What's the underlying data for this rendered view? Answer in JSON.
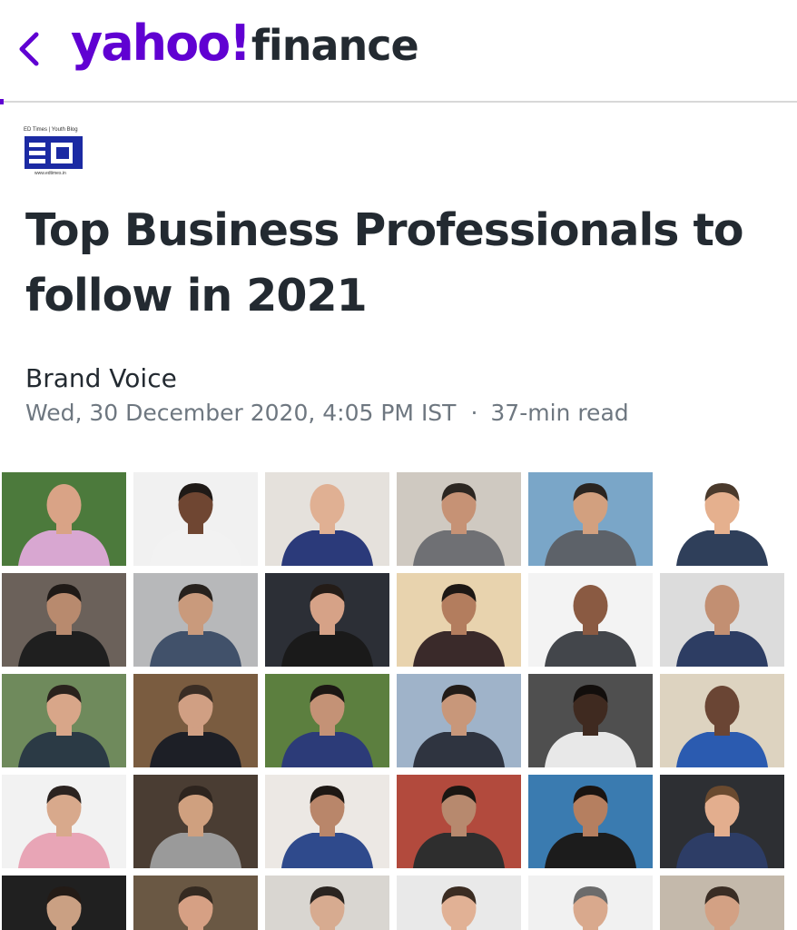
{
  "header": {
    "back_icon": "chevron-left-icon",
    "logo_yahoo": "yahoo!",
    "logo_finance": "finance",
    "brand_color": "#6001d2"
  },
  "publisher": {
    "top_text": "ED Times | Youth Blog",
    "mark": "ED",
    "url": "www.edtimes.in",
    "color": "#1b2aa3"
  },
  "article": {
    "title": "Top Business Professionals to follow in 2021",
    "brand": "Brand Voice",
    "date": "Wed, 30 December 2020, 4:05 PM IST",
    "separator": "·",
    "read_time": "37-min read"
  },
  "grid": {
    "photos": [
      {
        "bg": "#4c7a3c",
        "shirt": "#d8a7d1",
        "skin": "#d9a386",
        "hair": "none"
      },
      {
        "bg": "#f1f1f1",
        "shirt": "#f2f2f2",
        "skin": "#6f4632",
        "hair": "#1f1a17"
      },
      {
        "bg": "#e5e1dc",
        "shirt": "#2b3a7a",
        "skin": "#e0b093",
        "hair": "none"
      },
      {
        "bg": "#cfc9c1",
        "shirt": "#6f7074",
        "skin": "#c69275",
        "hair": "#2c2621"
      },
      {
        "bg": "#7aa6c8",
        "shirt": "#5d6269",
        "skin": "#d2a07f",
        "hair": "#2a2420"
      },
      {
        "bg": "#ffffff",
        "shirt": "#2f3f5a",
        "skin": "#e5b08e",
        "hair": "#4a3a2c"
      },
      {
        "bg": "#6b615a",
        "shirt": "#1f1f1f",
        "skin": "#b88a6e",
        "hair": "#1f1a17"
      },
      {
        "bg": "#b7b8ba",
        "shirt": "#41516a",
        "skin": "#c99a7c",
        "hair": "#27211d"
      },
      {
        "bg": "#2c2f36",
        "shirt": "#1a1a1a",
        "skin": "#d6a287",
        "hair": "#241c17"
      },
      {
        "bg": "#e8d3ae",
        "shirt": "#3a2a2a",
        "skin": "#b37d5e",
        "hair": "#1d1714"
      },
      {
        "bg": "#f3f3f3",
        "shirt": "#43464b",
        "skin": "#8a5a42",
        "hair": "none"
      },
      {
        "bg": "#dcdcdc",
        "shirt": "#2d3d63",
        "skin": "#c28f72",
        "hair": "none"
      },
      {
        "bg": "#6f8a5c",
        "shirt": "#2b3a45",
        "skin": "#d8a689",
        "hair": "#2a221d"
      },
      {
        "bg": "#7a5c40",
        "shirt": "#1d1f26",
        "skin": "#d09f83",
        "hair": "#3a2d24"
      },
      {
        "bg": "#5c7f3f",
        "shirt": "#2c3b78",
        "skin": "#c49276",
        "hair": "#1c1714"
      },
      {
        "bg": "#9fb3c9",
        "shirt": "#2f3440",
        "skin": "#c8977a",
        "hair": "#221b17"
      },
      {
        "bg": "#4f4f4f",
        "shirt": "#e8e8e8",
        "skin": "#3f2a20",
        "hair": "#120e0c"
      },
      {
        "bg": "#ddd3c0",
        "shirt": "#2b5bb0",
        "skin": "#6a4534",
        "hair": "none"
      },
      {
        "bg": "#f2f2f2",
        "shirt": "#e8a5b6",
        "skin": "#d8a98c",
        "hair": "#2b2320"
      },
      {
        "bg": "#4a3d33",
        "shirt": "#9a9a9a",
        "skin": "#cfa07f",
        "hair": "#2d241e"
      },
      {
        "bg": "#ece8e4",
        "shirt": "#2f4a8c",
        "skin": "#b9866a",
        "hair": "#1e1814"
      },
      {
        "bg": "#b24a3d",
        "shirt": "#2e2e2e",
        "skin": "#b7896e",
        "hair": "#1b1612"
      },
      {
        "bg": "#3a7bb0",
        "shirt": "#1c1c1c",
        "skin": "#b57f60",
        "hair": "#1a1411"
      },
      {
        "bg": "#2d2f33",
        "shirt": "#2d3d66",
        "skin": "#e3ae8e",
        "hair": "#6a4a2f"
      },
      {
        "bg": "#202020",
        "shirt": "#111111",
        "skin": "#caa083",
        "hair": "#231b16"
      },
      {
        "bg": "#6a5844",
        "shirt": "#2e2e2e",
        "skin": "#d6a084",
        "hair": "#352a21"
      },
      {
        "bg": "#d9d6d1",
        "shirt": "#3b3b3b",
        "skin": "#d7ab90",
        "hair": "#2a2420"
      },
      {
        "bg": "#e9e9e9",
        "shirt": "#2d3f6b",
        "skin": "#e1b195",
        "hair": "#3b2c22"
      },
      {
        "bg": "#f1f1f1",
        "shirt": "#515a63",
        "skin": "#d9a98d",
        "hair": "#6b6b6b"
      },
      {
        "bg": "#c4b9ab",
        "shirt": "#40362e",
        "skin": "#d3a184",
        "hair": "#3a2d24"
      }
    ]
  }
}
